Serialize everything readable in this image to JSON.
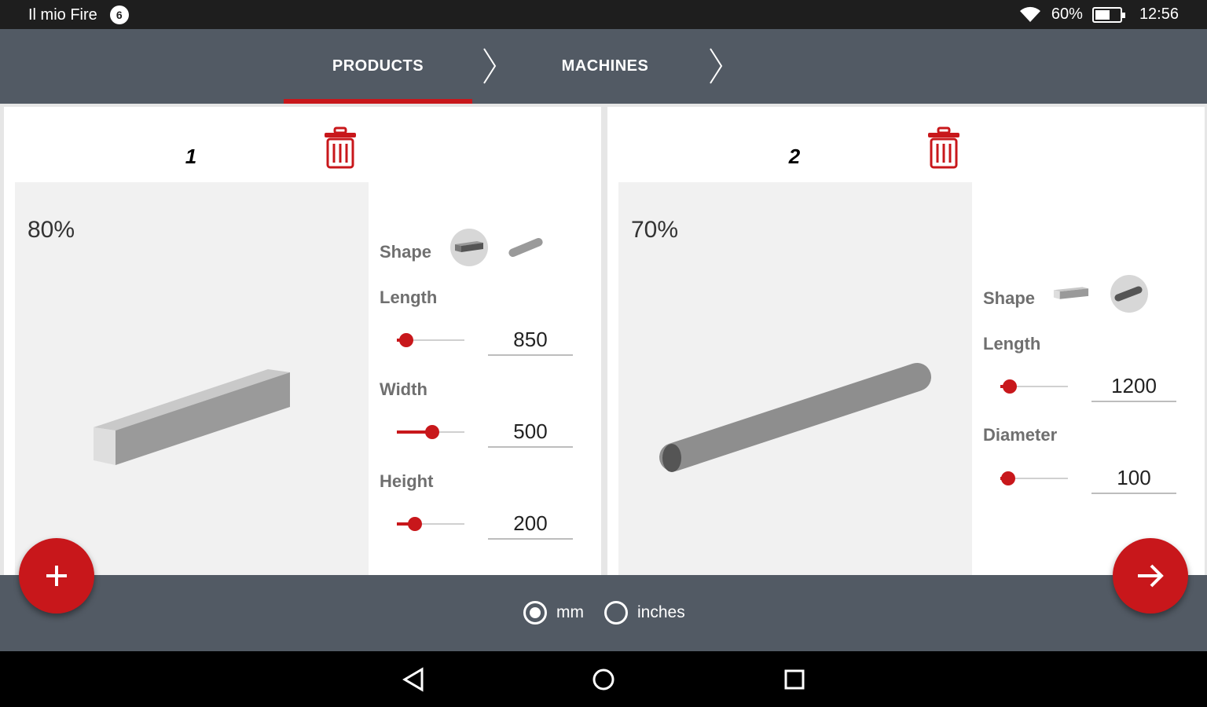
{
  "status_bar": {
    "device_name": "Il mio Fire",
    "notification_count": "6",
    "battery": "60%",
    "battery_level": 0.6,
    "time": "12:56"
  },
  "tabs": [
    {
      "label": "PRODUCTS",
      "active": true
    },
    {
      "label": "MACHINES",
      "active": false
    }
  ],
  "products": [
    {
      "number": "1",
      "percent": "80%",
      "shape": "rectangular-bar",
      "shape_label": "Shape",
      "fields": [
        {
          "label": "Length",
          "value": "850",
          "slider_level": 0.04
        },
        {
          "label": "Width",
          "value": "500",
          "slider_level": 0.42
        },
        {
          "label": "Height",
          "value": "200",
          "slider_level": 0.16
        }
      ]
    },
    {
      "number": "2",
      "percent": "70%",
      "shape": "round-bar",
      "shape_label": "Shape",
      "fields": [
        {
          "label": "Length",
          "value": "1200",
          "slider_level": 0.04
        },
        {
          "label": "Diameter",
          "value": "100",
          "slider_level": 0.01
        }
      ]
    }
  ],
  "units": {
    "options": [
      {
        "label": "mm",
        "checked": true
      },
      {
        "label": "inches",
        "checked": false
      }
    ]
  },
  "icons": {
    "add": "plus-icon",
    "next": "arrow-right-icon",
    "delete": "trash-icon"
  },
  "colors": {
    "accent": "#c8171b",
    "bar": "#525a64"
  }
}
